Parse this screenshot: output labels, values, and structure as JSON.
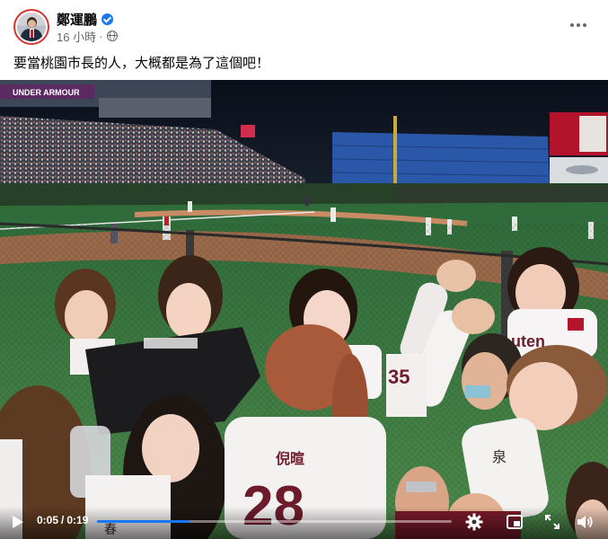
{
  "post": {
    "author": "鄭運鵬",
    "timestamp": "16 小時",
    "separator": "·",
    "text": "要當桃園市長的人，大概都是為了這個吧！"
  },
  "video": {
    "time_current": "0:05",
    "time_separator": "/",
    "time_total": "0:19",
    "progress_fraction": 0.26,
    "scene_text": {
      "banner": "UNDER ARMOUR",
      "jersey_back_name": "倪暄",
      "jersey_back_number": "28",
      "jersey_front_text": "Rakuten",
      "jersey_partial": "uten",
      "jersey_char_left": "春",
      "jersey_char_right": "泉"
    }
  },
  "colors": {
    "accent": "#1877f2",
    "secondary_text": "#65676b",
    "team_red": "#7a1a2a"
  },
  "icons": {
    "verified": "verified-badge-icon",
    "privacy": "globe-icon",
    "more": "more-options-icon",
    "play": "play-icon",
    "settings": "gear-icon",
    "pip": "picture-in-picture-icon",
    "fullscreen": "fullscreen-icon",
    "volume": "volume-icon"
  }
}
